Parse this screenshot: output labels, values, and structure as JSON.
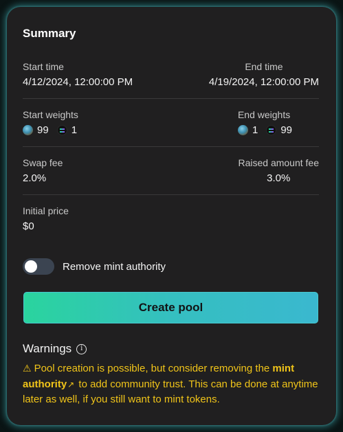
{
  "summary": {
    "title": "Summary",
    "start_time_label": "Start time",
    "start_time_value": "4/12/2024, 12:00:00 PM",
    "end_time_label": "End time",
    "end_time_value": "4/19/2024, 12:00:00 PM",
    "start_weights_label": "Start weights",
    "start_weights": [
      {
        "icon": "token-a-icon",
        "value": "99"
      },
      {
        "icon": "solana-icon",
        "value": "1"
      }
    ],
    "end_weights_label": "End weights",
    "end_weights": [
      {
        "icon": "token-a-icon",
        "value": "1"
      },
      {
        "icon": "solana-icon",
        "value": "99"
      }
    ],
    "swap_fee_label": "Swap fee",
    "swap_fee_value": "2.0%",
    "raised_fee_label": "Raised amount fee",
    "raised_fee_value": "3.0%",
    "initial_price_label": "Initial price",
    "initial_price_value": "$0"
  },
  "toggle": {
    "label": "Remove mint authority",
    "checked": false
  },
  "create_button": {
    "label": "Create pool"
  },
  "warnings": {
    "title": "Warnings",
    "text_before": "Pool creation is possible, but consider removing the ",
    "link_text": "mint authority",
    "text_after": " to add community trust. This can be done at anytime later as well, if you still want to mint tokens."
  },
  "colors": {
    "card_bg": "#201f20",
    "accent_glow": "#40aaaf",
    "button_gradient_start": "#2ad49e",
    "button_gradient_end": "#3ab8cf",
    "warning": "#f0c419"
  }
}
